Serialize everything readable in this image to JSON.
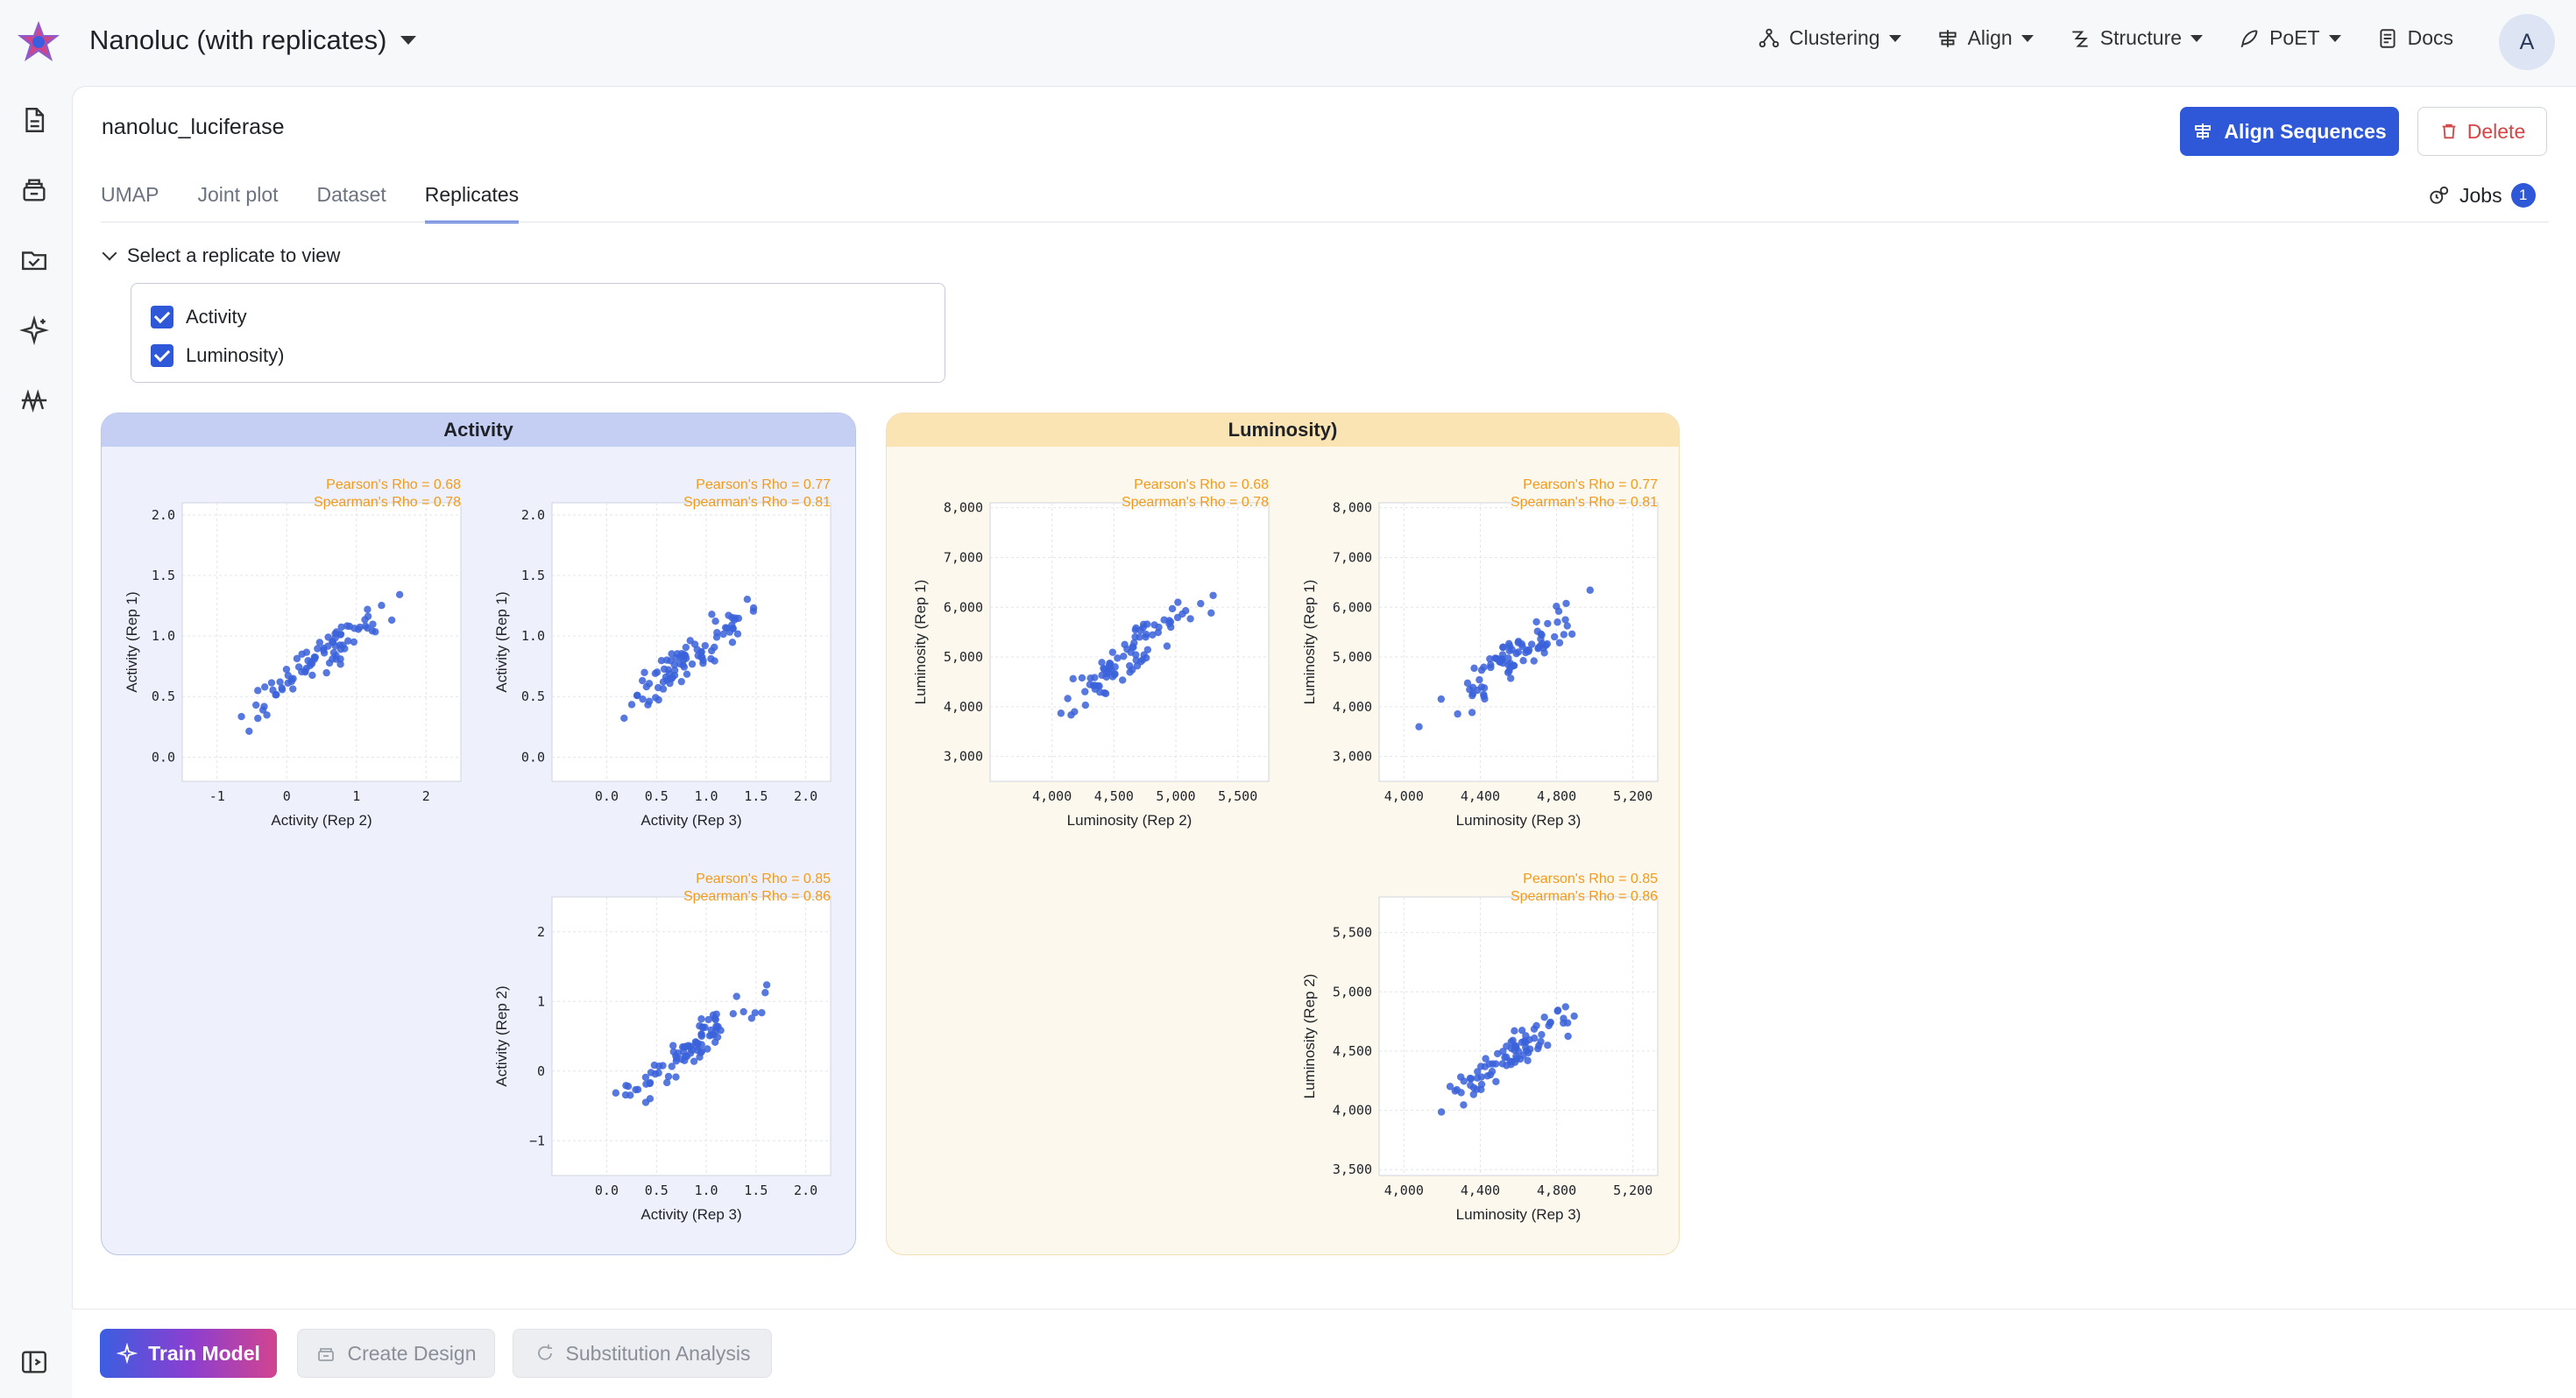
{
  "header": {
    "project_title": "Nanoluc (with replicates)",
    "menu": [
      {
        "label": "Clustering",
        "icon": "clustering-icon"
      },
      {
        "label": "Align",
        "icon": "align-icon"
      },
      {
        "label": "Structure",
        "icon": "structure-icon"
      },
      {
        "label": "PoET",
        "icon": "poet-icon"
      },
      {
        "label": "Docs",
        "icon": "docs-icon"
      }
    ],
    "avatar": "A"
  },
  "sidebar": {
    "icons": [
      "document-icon",
      "database-icon",
      "folder-check-icon",
      "sparkle-icon",
      "chart-icon"
    ],
    "bottom_icon": "collapse-sidebar-icon"
  },
  "main": {
    "dataset_title": "nanoluc_luciferase",
    "align_button": "Align Sequences",
    "delete_button": "Delete",
    "tabs": [
      "UMAP",
      "Joint plot",
      "Dataset",
      "Replicates"
    ],
    "active_tab": "Replicates",
    "jobs_label": "Jobs",
    "jobs_count": "1",
    "selector_label": "Select a replicate to view",
    "replicates": [
      {
        "label": "Activity",
        "checked": true
      },
      {
        "label": "Luminosity)",
        "checked": true
      }
    ]
  },
  "colors": {
    "accent": "#2f58d8",
    "point": "#3a62d9",
    "rho": "#f39a1c",
    "activity_header": "#c4cff3",
    "luminosity_header": "#fbe4b3"
  },
  "panels": {
    "activity_title": "Activity",
    "luminosity_title": "Luminosity)"
  },
  "chart_data": [
    {
      "type": "scatter",
      "group": "Activity",
      "xlabel": "Activity (Rep 2)",
      "ylabel": "Activity (Rep 1)",
      "pearson": "Pearson's Rho = 0.68",
      "spearman": "Spearman's Rho = 0.78",
      "xticks": [
        "-1",
        "0",
        "1",
        "2"
      ],
      "yticks": [
        "2.0",
        "1.5",
        "1.0",
        "0.5",
        "0.0"
      ],
      "xlim": [
        -1.5,
        2.5
      ],
      "ylim": [
        -0.2,
        2.1
      ]
    },
    {
      "type": "scatter",
      "group": "Activity",
      "xlabel": "Activity (Rep 3)",
      "ylabel": "Activity (Rep 1)",
      "pearson": "Pearson's Rho = 0.77",
      "spearman": "Spearman's Rho = 0.81",
      "xticks": [
        "0.0",
        "0.5",
        "1.0",
        "1.5",
        "2.0"
      ],
      "yticks": [
        "2.0",
        "1.5",
        "1.0",
        "0.5",
        "0.0"
      ],
      "xlim": [
        -0.55,
        2.25
      ],
      "ylim": [
        -0.2,
        2.1
      ]
    },
    {
      "type": "scatter",
      "group": "Activity",
      "xlabel": "Activity (Rep 3)",
      "ylabel": "Activity (Rep 2)",
      "pearson": "Pearson's Rho = 0.85",
      "spearman": "Spearman's Rho = 0.86",
      "xticks": [
        "0.0",
        "0.5",
        "1.0",
        "1.5",
        "2.0"
      ],
      "yticks": [
        "2",
        "1",
        "0",
        "−1"
      ],
      "xlim": [
        -0.55,
        2.25
      ],
      "ylim": [
        -1.5,
        2.5
      ]
    },
    {
      "type": "scatter",
      "group": "Luminosity)",
      "xlabel": "Luminosity (Rep 2)",
      "ylabel": "Luminosity (Rep 1)",
      "pearson": "Pearson's Rho = 0.68",
      "spearman": "Spearman's Rho = 0.78",
      "xticks": [
        "4,000",
        "4,500",
        "5,000",
        "5,500"
      ],
      "yticks": [
        "8,000",
        "7,000",
        "6,000",
        "5,000",
        "4,000",
        "3,000"
      ],
      "xlim": [
        3500,
        5750
      ],
      "ylim": [
        2500,
        8100
      ]
    },
    {
      "type": "scatter",
      "group": "Luminosity)",
      "xlabel": "Luminosity (Rep 3)",
      "ylabel": "Luminosity (Rep 1)",
      "pearson": "Pearson's Rho = 0.77",
      "spearman": "Spearman's Rho = 0.81",
      "xticks": [
        "4,000",
        "4,400",
        "4,800",
        "5,200"
      ],
      "yticks": [
        "8,000",
        "7,000",
        "6,000",
        "5,000",
        "4,000",
        "3,000"
      ],
      "xlim": [
        3870,
        5330
      ],
      "ylim": [
        2500,
        8100
      ]
    },
    {
      "type": "scatter",
      "group": "Luminosity)",
      "xlabel": "Luminosity (Rep 3)",
      "ylabel": "Luminosity (Rep 2)",
      "pearson": "Pearson's Rho = 0.85",
      "spearman": "Spearman's Rho = 0.86",
      "xticks": [
        "4,000",
        "4,400",
        "4,800",
        "5,200"
      ],
      "yticks": [
        "5,500",
        "5,000",
        "4,500",
        "4,000",
        "3,500"
      ],
      "xlim": [
        3870,
        5330
      ],
      "ylim": [
        3450,
        5800
      ]
    }
  ],
  "bottom": {
    "train_model": "Train Model",
    "create_design": "Create Design",
    "substitution_analysis": "Substitution Analysis"
  }
}
